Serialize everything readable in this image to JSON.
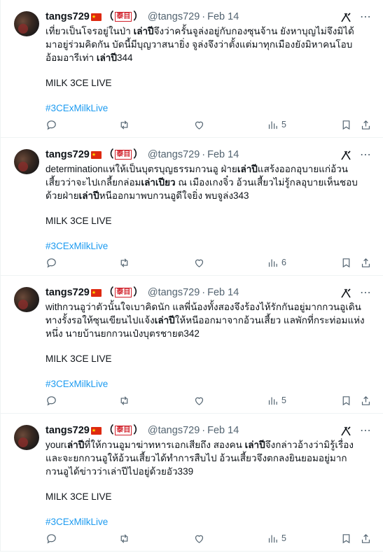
{
  "tweets": [
    {
      "name": "tangs729",
      "paren_open": "（",
      "kanji": "泰目",
      "paren_close": "）",
      "handle": "@tangs729",
      "dot": "·",
      "date": "Feb 14",
      "text_parts": [
        {
          "t": "เที่ยวเป็นโจรอยู่ในป่า ",
          "b": false
        },
        {
          "t": "เล่าปี",
          "b": true
        },
        {
          "t": "จึงว่าครั้นจูล่งอยู่กับกองซุนจ้าน ยังหาบุญไม่จึงมิได้มาอยู่ร่วมคิดกัน บัดนี้มีบุญวาสนายิ่ง จูล่งจึงว่าตั้งแต่มาทุกเมืองยังมิหาคนโอบอ้อมอารีเท่า ",
          "b": false
        },
        {
          "t": "เล่าปี",
          "b": true
        },
        {
          "t": "344",
          "b": false
        }
      ],
      "live": "MILK 3CE LIVE",
      "hashtag": "#3CExMilkLive",
      "views": "5"
    },
    {
      "name": "tangs729",
      "paren_open": "（",
      "kanji": "泰目",
      "paren_close": "）",
      "handle": "@tangs729",
      "dot": "·",
      "date": "Feb 14",
      "text_parts": [
        {
          "t": "determinationแห่ให้เป็นบุตรบุญธรรมกวนอู ฝ่าย",
          "b": false
        },
        {
          "t": "เล่าปี",
          "b": true
        },
        {
          "t": "แสร้งออกอุบายแก่อ้วนเสี้ยวว่าจะไปเกลี้ยกล่อม",
          "b": false
        },
        {
          "t": "เล่าเปียว",
          "b": true
        },
        {
          "t": " ณ เมืองเกงจิ๋ว อ้วนเสี้ยวไม่รู้กลอุบายเห็นชอบด้วยฝ่าย",
          "b": false
        },
        {
          "t": "เล่าปี",
          "b": true
        },
        {
          "t": "หนีออกมาพบกวนอูดีใจยิ่ง พบจูล่ง343",
          "b": false
        }
      ],
      "live": "MILK 3CE LIVE",
      "hashtag": "#3CExMilkLive",
      "views": "6"
    },
    {
      "name": "tangs729",
      "paren_open": "（",
      "kanji": "泰目",
      "paren_close": "）",
      "handle": "@tangs729",
      "dot": "·",
      "date": "Feb 14",
      "text_parts": [
        {
          "t": "withกวนอูว่าตัวนั้นใจเบาคิดนัก แลพี่น้องทั้งสองจึงร้องไห้รักกันอยู่มากกวนอูเดินทางรั้งรอให้ซุนเขียนไปแจ้ง",
          "b": false
        },
        {
          "t": "เล่าปี",
          "b": true
        },
        {
          "t": "ให้หนีออกมาจากอ้วนเสี้ยว แลพักที่กระท่อมแห่งหนึ่ง นายบ้านยกกวนเป๋งบุตรชายต342",
          "b": false
        }
      ],
      "live": "MILK 3CE LIVE",
      "hashtag": "#3CExMilkLive",
      "views": "5"
    },
    {
      "name": "tangs729",
      "paren_open": "（",
      "kanji": "泰目",
      "paren_close": "）",
      "handle": "@tangs729",
      "dot": "·",
      "date": "Feb 14",
      "text_parts": [
        {
          "t": "yourเ",
          "b": false
        },
        {
          "t": "ล่าปี",
          "b": true
        },
        {
          "t": "ที่ให้กวนอูมาฆ่าทหารเอกเสียถึง สองคน ",
          "b": false
        },
        {
          "t": "เล่าปี",
          "b": true
        },
        {
          "t": "จึงกล่าวอ้างว่ามิรู้เรื่องและจะยกกวนอูให้อ้วนเสี้ยวได้ทำการสืบไป อ้วนเสี้ยวจึงตกลงยินยอมอยู่มากกวนอูได้ข่าวว่าเล่าปีไปอยู่ด้วยอัว339",
          "b": false
        }
      ],
      "live": "MILK 3CE LIVE",
      "hashtag": "#3CExMilkLive",
      "views": "5"
    }
  ],
  "icons": {
    "reply": "reply-icon",
    "retweet": "retweet-icon",
    "like": "heart-icon",
    "views": "views-chart-icon",
    "bookmark": "bookmark-icon",
    "share": "share-icon",
    "grok": "grok-icon"
  }
}
